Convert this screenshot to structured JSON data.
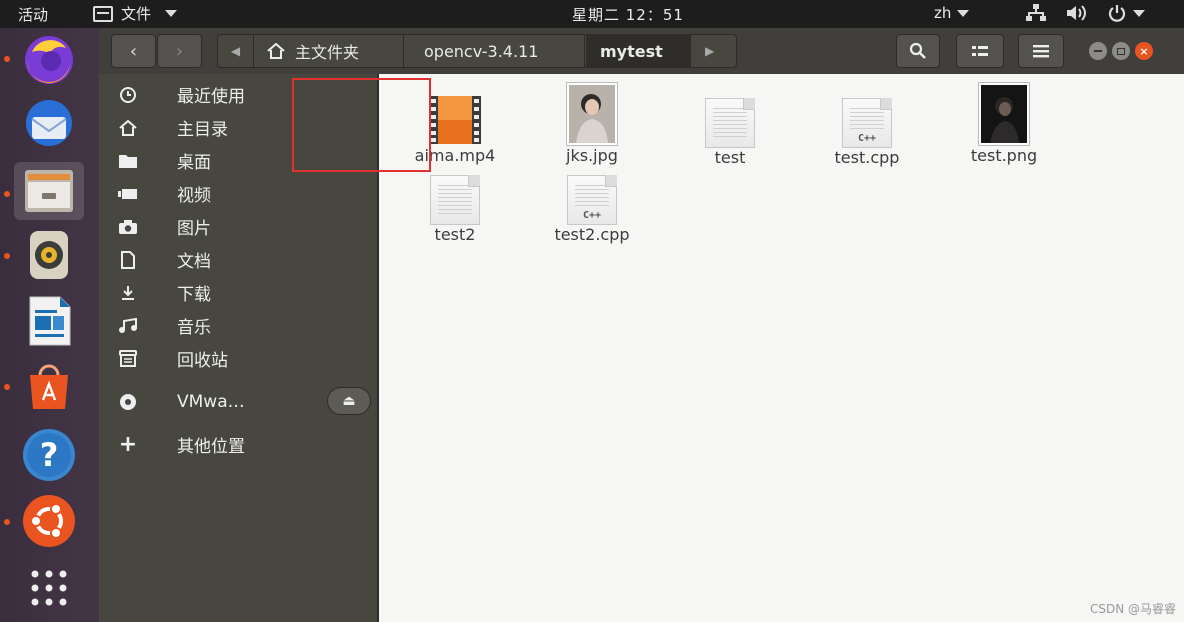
{
  "topbar": {
    "activities": "活动",
    "app_menu": "文件",
    "clock": "星期二 12：51",
    "language": "zh"
  },
  "dock": {
    "items": [
      {
        "name": "firefox",
        "running": true
      },
      {
        "name": "thunderbird",
        "running": false
      },
      {
        "name": "files",
        "running": true,
        "active": true
      },
      {
        "name": "rhythmbox",
        "running": true
      },
      {
        "name": "libreoffice-writer",
        "running": false
      },
      {
        "name": "ubuntu-software",
        "running": true
      },
      {
        "name": "help",
        "running": false
      },
      {
        "name": "ubuntu-settings",
        "running": true
      },
      {
        "name": "show-applications",
        "running": false
      }
    ]
  },
  "headerbar": {
    "breadcrumbs": [
      "主文件夹",
      "opencv-3.4.11",
      "mytest"
    ],
    "current": "mytest"
  },
  "sidebar": {
    "items": [
      {
        "label": "最近使用",
        "icon": "clock-icon"
      },
      {
        "label": "主目录",
        "icon": "home-icon"
      },
      {
        "label": "桌面",
        "icon": "folder-icon"
      },
      {
        "label": "视频",
        "icon": "video-icon"
      },
      {
        "label": "图片",
        "icon": "camera-icon"
      },
      {
        "label": "文档",
        "icon": "document-icon"
      },
      {
        "label": "下载",
        "icon": "download-icon"
      },
      {
        "label": "音乐",
        "icon": "music-icon"
      },
      {
        "label": "回收站",
        "icon": "trash-icon"
      },
      {
        "label": "VMwa…",
        "icon": "disc-icon"
      },
      {
        "label": "其他位置",
        "icon": "plus-icon"
      }
    ]
  },
  "files": [
    {
      "name": "aima.mp4",
      "type": "video",
      "selected": true
    },
    {
      "name": "jks.jpg",
      "type": "image"
    },
    {
      "name": "test",
      "type": "text"
    },
    {
      "name": "test.cpp",
      "type": "cpp"
    },
    {
      "name": "test.png",
      "type": "image-dark"
    },
    {
      "name": "test2",
      "type": "text"
    },
    {
      "name": "test2.cpp",
      "type": "cpp"
    }
  ],
  "colors": {
    "accent": "#e95420",
    "highlight_border": "#e03030"
  },
  "watermark": "CSDN @马睿睿"
}
